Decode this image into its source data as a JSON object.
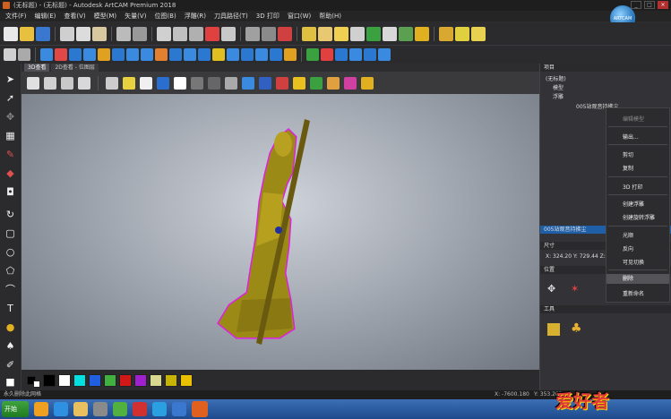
{
  "window": {
    "title": "(无标题) - (无标题) - Autodesk ArtCAM Premium 2018",
    "minimize": "_",
    "maximize": "□",
    "close": "×"
  },
  "menu": [
    "文件(F)",
    "编辑(E)",
    "查看(V)",
    "模型(M)",
    "矢量(V)",
    "位图(B)",
    "浮雕(R)",
    "刀具路径(T)",
    "3D 打印",
    "窗口(W)",
    "帮助(H)"
  ],
  "logo_text": "ARTCAM",
  "view_tabs": [
    "3D查看",
    "2D查看 - 位图层"
  ],
  "palette_colors": [
    "#000000",
    "#ffffff",
    "#00e0e0",
    "#2060e0",
    "#40b040",
    "#d01818",
    "#a020d0",
    "#d8d890",
    "#c8b400",
    "#e8c000"
  ],
  "status": {
    "left": "永久删除此网格",
    "x": "X: -7600.180",
    "y": "Y: 353.201"
  },
  "panel": {
    "project_header": "项目",
    "tree_root": "(无标题)",
    "tree_models": "模型",
    "tree_reliefs": "浮雕",
    "tree_item": "005站观音持拂尘",
    "object_header": "005站观音持拂尘",
    "size_header": "尺寸",
    "size_values": "X: 324.20  Y: 729.44  Z: 86.52",
    "position_header": "位置",
    "tools_header": "工具"
  },
  "context_menu": [
    "编辑模型",
    "输出...",
    "剪切",
    "复制",
    "3D 打印",
    "创建浮雕",
    "创建旋转浮雕",
    "光顺",
    "反向",
    "可见切换",
    "删除",
    "重新命名"
  ],
  "taskbar": {
    "start": "开始"
  },
  "watermark": "爱好者"
}
